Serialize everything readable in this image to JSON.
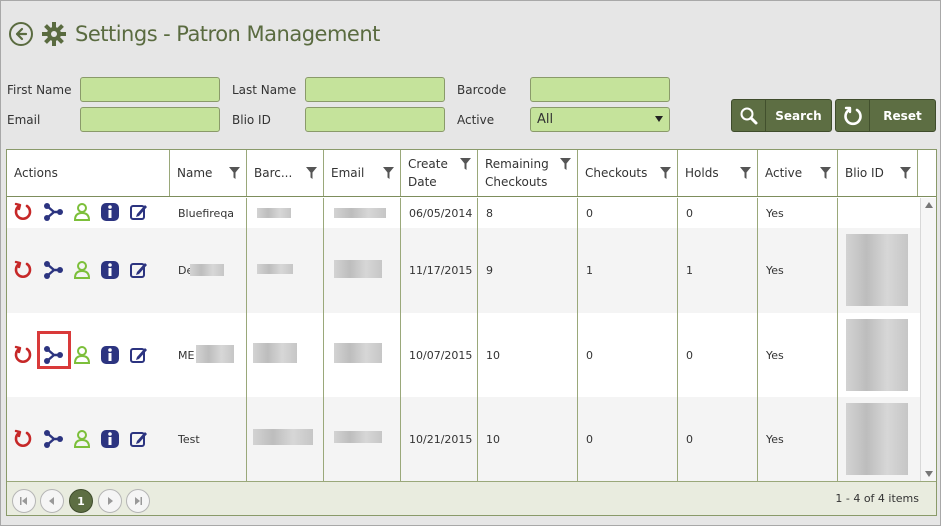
{
  "header": {
    "title_main": "Settings",
    "title_sep": "-",
    "title_sub": "Patron Management"
  },
  "filters": {
    "first_name_label": "First Name",
    "last_name_label": "Last Name",
    "barcode_label": "Barcode",
    "email_label": "Email",
    "blio_id_label": "Blio ID",
    "active_label": "Active",
    "active_value": "All"
  },
  "buttons": {
    "search": "Search",
    "reset": "Reset"
  },
  "grid": {
    "columns": {
      "actions": "Actions",
      "name": "Name",
      "barcode": "Barc...",
      "email": "Email",
      "create_date_1": "Create",
      "create_date_2": "Date",
      "remaining_1": "Remaining",
      "remaining_2": "Checkouts",
      "checkouts": "Checkouts",
      "holds": "Holds",
      "active": "Active",
      "blio_id": "Blio ID"
    },
    "rows": [
      {
        "name": "Bluefireqa",
        "create_date": "06/05/2014",
        "remaining": "8",
        "checkouts": "0",
        "holds": "0",
        "active": "Yes"
      },
      {
        "name": "De",
        "create_date": "11/17/2015",
        "remaining": "9",
        "checkouts": "1",
        "holds": "1",
        "active": "Yes"
      },
      {
        "name": "ME",
        "create_date": "10/07/2015",
        "remaining": "10",
        "checkouts": "0",
        "holds": "0",
        "active": "Yes"
      },
      {
        "name": "Test",
        "create_date": "10/21/2015",
        "remaining": "10",
        "checkouts": "0",
        "holds": "0",
        "active": "Yes"
      }
    ]
  },
  "pager": {
    "current_page": "1",
    "info": "1 - 4 of 4 items"
  },
  "colors": {
    "accent": "#5d6e43",
    "input_fill": "#c5e39b",
    "highlight": "#d93a3a"
  }
}
